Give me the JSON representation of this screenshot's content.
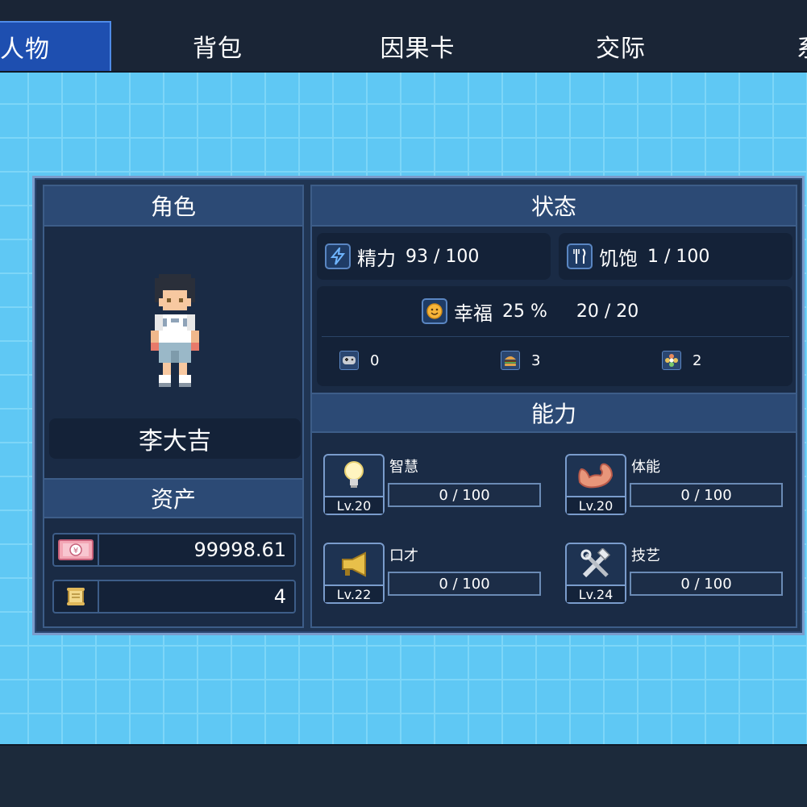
{
  "nav": {
    "tabs": [
      "人物",
      "背包",
      "因果卡",
      "交际",
      "系"
    ],
    "active_tab": "人物"
  },
  "character": {
    "header": "角色",
    "name": "李大吉"
  },
  "assets": {
    "header": "资产",
    "money": "99998.61",
    "money_icon": "cash-icon",
    "scroll_count": "4",
    "scroll_icon": "scroll-icon"
  },
  "status": {
    "header": "状态",
    "energy": {
      "label": "精力",
      "value": "93 / 100",
      "icon": "lightning-icon"
    },
    "hunger": {
      "label": "饥饱",
      "value": "1 / 100",
      "icon": "fork-knife-icon"
    },
    "happiness": {
      "label": "幸福",
      "percent": "25 %",
      "value": "20 / 20",
      "icon": "smiley-icon"
    },
    "mini": [
      {
        "icon": "gamepad-icon",
        "value": "0"
      },
      {
        "icon": "burger-icon",
        "value": "3"
      },
      {
        "icon": "flower-icon",
        "value": "2"
      }
    ]
  },
  "abilities": {
    "header": "能力",
    "items": [
      {
        "name": "智慧",
        "level": "Lv.20",
        "progress": "0 / 100",
        "icon": "lightbulb-icon"
      },
      {
        "name": "体能",
        "level": "Lv.20",
        "progress": "0 / 100",
        "icon": "muscle-arm-icon"
      },
      {
        "name": "口才",
        "level": "Lv.22",
        "progress": "0 / 100",
        "icon": "megaphone-icon"
      },
      {
        "name": "技艺",
        "level": "Lv.24",
        "progress": "0 / 100",
        "icon": "tools-icon"
      }
    ]
  },
  "colors": {
    "accent": "#1e4fb0",
    "background": "#5fc8f4",
    "panel": "#203553"
  }
}
